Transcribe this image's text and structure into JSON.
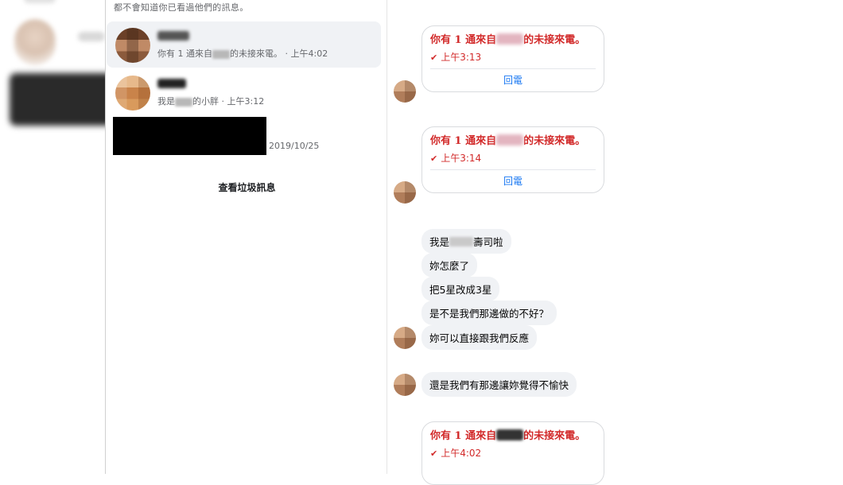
{
  "conversation_list": {
    "top_note": "都不會知道你已看過他們的訊息。",
    "items": [
      {
        "preview_before": "你有 1 通來自",
        "preview_after": "的未接來電。",
        "time": "上午4:02"
      },
      {
        "preview_before": "我是",
        "preview_after": "的小胖",
        "time": "上午3:12"
      },
      {
        "time": "2019/10/25"
      }
    ],
    "spam_link": "查看垃圾訊息"
  },
  "thread": {
    "calls": [
      {
        "text_before": "你有 1 通來自",
        "text_after": "的未接來電。",
        "time": "上午3:13",
        "callback": "回電"
      },
      {
        "text_before": "你有 1 通來自",
        "text_after": "的未接來電。",
        "time": "上午3:14",
        "callback": "回電"
      },
      {
        "text_before": "你有 1 通來自",
        "text_after": "的未接來電。",
        "time": "上午4:02"
      }
    ],
    "messages": {
      "m1_before": "我是",
      "m1_after": "壽司啦",
      "m2": "妳怎麼了",
      "m3": "把5星改成3星",
      "m4": "是不是我們那邊做的不好？",
      "m5": "妳可以直接跟我們反應",
      "m6": "還是我們有那邊讓妳覺得不愉快"
    }
  },
  "colors": {
    "missed_call_red": "#d22a2a",
    "link_blue": "#1877f2",
    "bubble_gray": "#f0f2f5"
  }
}
